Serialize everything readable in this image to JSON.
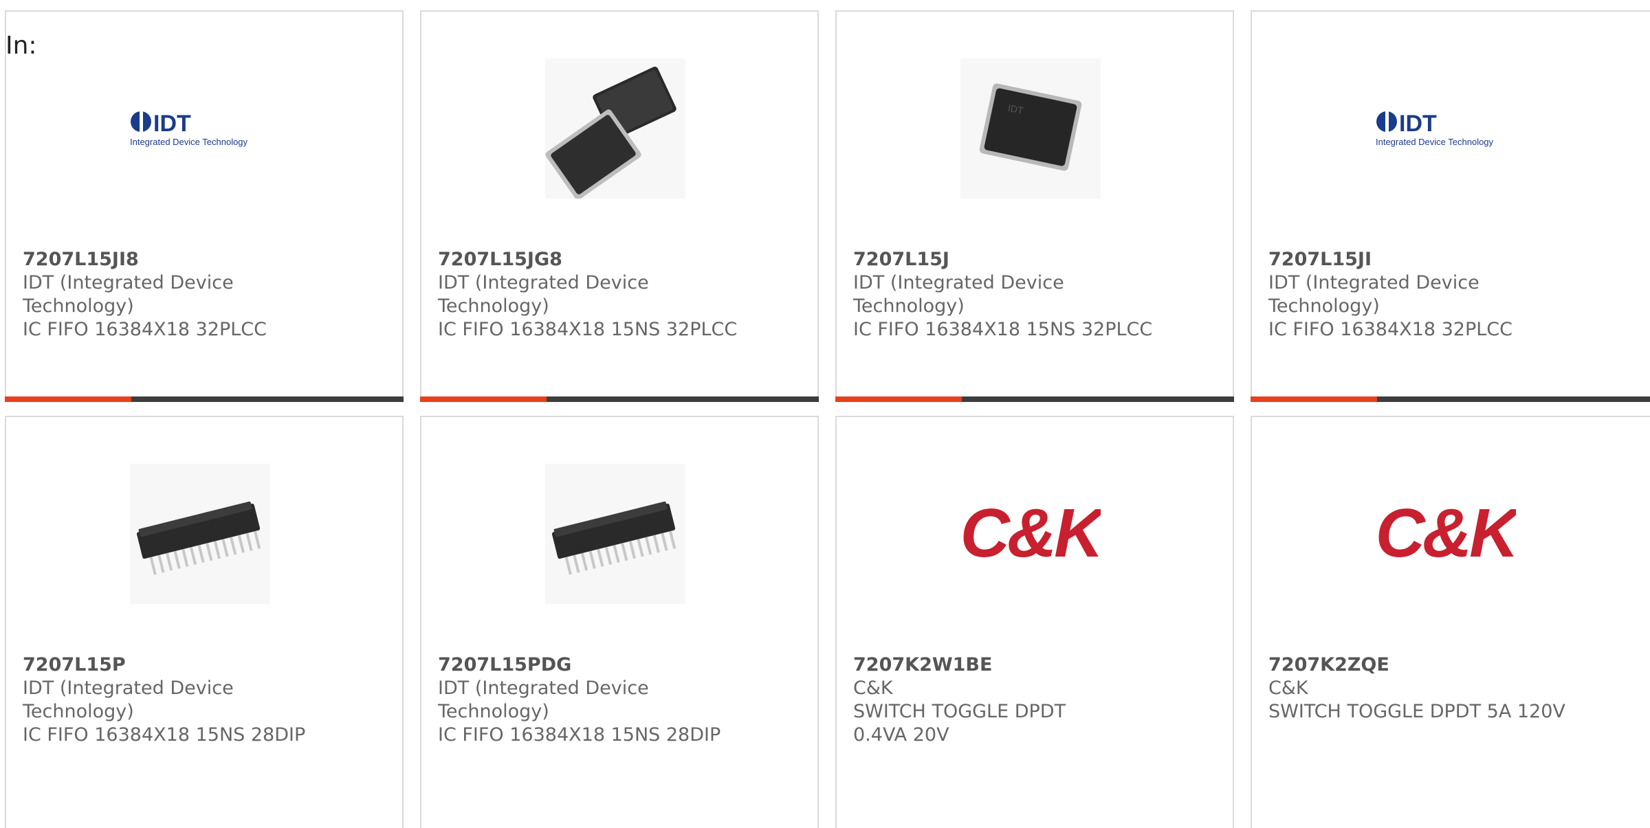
{
  "filter_label": "In:",
  "colors": {
    "accent": "#e8401c",
    "bar": "#3d3d3d",
    "ck_red": "#c8202f",
    "idt_blue": "#1a3c8c"
  },
  "cards": [
    {
      "part": "7207L15JI8",
      "manufacturer": "IDT (Integrated Device Technology)",
      "description": "IC FIFO 16384X18 32PLCC",
      "image": "idt-logo"
    },
    {
      "part": "7207L15JG8",
      "manufacturer": "IDT (Integrated Device Technology)",
      "description": "IC FIFO 16384X18 15NS 32PLCC",
      "image": "plcc-chips-photo"
    },
    {
      "part": "7207L15J",
      "manufacturer": "IDT (Integrated Device Technology)",
      "description": "IC FIFO 16384X18 15NS 32PLCC",
      "image": "plcc-chip-photo"
    },
    {
      "part": "7207L15JI",
      "manufacturer": "IDT (Integrated Device Technology)",
      "description": "IC FIFO 16384X18 32PLCC",
      "image": "idt-logo"
    },
    {
      "part": "7207L15P",
      "manufacturer": "IDT (Integrated Device Technology)",
      "description": "IC FIFO 16384X18 15NS 28DIP",
      "image": "dip-chip-photo"
    },
    {
      "part": "7207L15PDG",
      "manufacturer": "IDT (Integrated Device Technology)",
      "description": "IC FIFO 16384X18 15NS 28DIP",
      "image": "dip-chip-photo"
    },
    {
      "part": "7207K2W1BE",
      "manufacturer": "C&K",
      "description": "SWITCH TOGGLE DPDT 0.4VA 20V",
      "image": "ck-logo"
    },
    {
      "part": "7207K2ZQE",
      "manufacturer": "C&K",
      "description": "SWITCH TOGGLE DPDT 5A 120V",
      "image": "ck-logo"
    }
  ]
}
